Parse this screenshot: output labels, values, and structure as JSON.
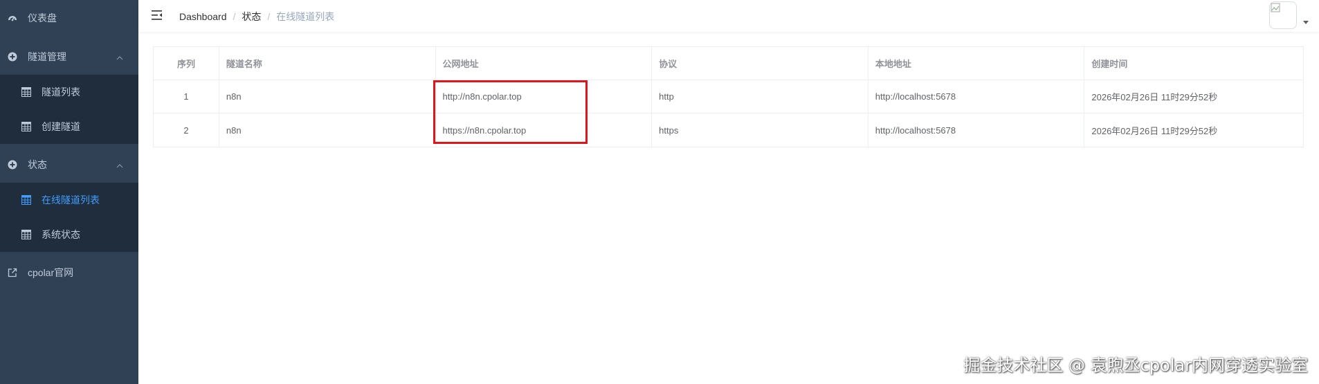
{
  "sidebar": {
    "items": [
      {
        "label": "仪表盘",
        "icon": "dashboard-icon"
      },
      {
        "label": "隧道管理",
        "icon": "plus-circle-icon",
        "expanded": true,
        "children": [
          {
            "label": "隧道列表",
            "icon": "table-icon"
          },
          {
            "label": "创建隧道",
            "icon": "table-icon"
          }
        ]
      },
      {
        "label": "状态",
        "icon": "plus-circle-icon",
        "expanded": true,
        "children": [
          {
            "label": "在线隧道列表",
            "icon": "table-icon",
            "active": true
          },
          {
            "label": "系统状态",
            "icon": "table-icon"
          }
        ]
      },
      {
        "label": "cpolar官网",
        "icon": "external-link-icon"
      }
    ],
    "bg_color": "#304156",
    "submenu_bg_color": "#1f2d3d",
    "active_color": "#409eff"
  },
  "header": {
    "breadcrumb": [
      "Dashboard",
      "状态",
      "在线隧道列表"
    ]
  },
  "table": {
    "columns": [
      "序列",
      "隧道名称",
      "公网地址",
      "协议",
      "本地地址",
      "创建时间"
    ],
    "rows": [
      [
        "1",
        "n8n",
        "http://n8n.cpolar.top",
        "http",
        "http://localhost:5678",
        "2026年02月26日 11时29分52秒"
      ],
      [
        "2",
        "n8n",
        "https://n8n.cpolar.top",
        "https",
        "http://localhost:5678",
        "2026年02月26日 11时29分52秒"
      ]
    ]
  },
  "annotation": {
    "color": "#e0161b"
  },
  "watermark": "掘金技术社区 @ 袁煦丞cpolar内网穿透实验室"
}
